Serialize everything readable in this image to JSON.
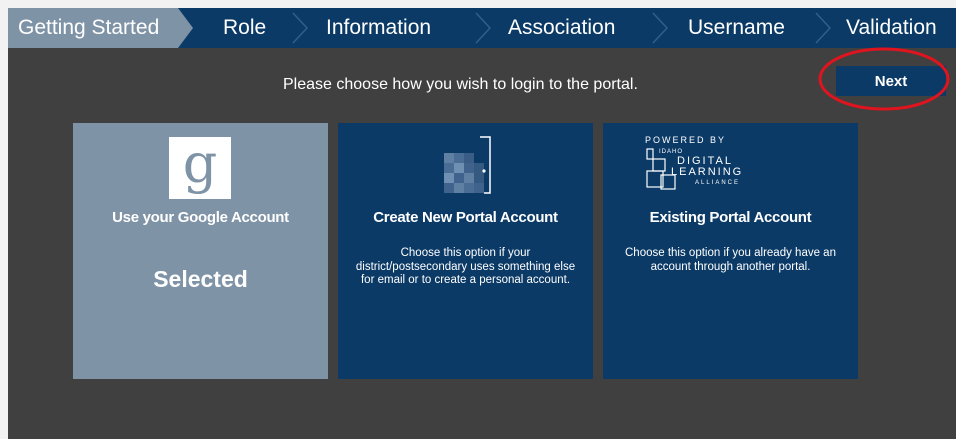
{
  "steps": [
    {
      "label": "Getting Started",
      "active": true
    },
    {
      "label": "Role"
    },
    {
      "label": "Information"
    },
    {
      "label": "Association"
    },
    {
      "label": "Username"
    },
    {
      "label": "Validation"
    }
  ],
  "main": {
    "prompt": "Please choose how you wish to login to the portal.",
    "next_label": "Next"
  },
  "cards": [
    {
      "icon": "google-g-icon",
      "logo_letter": "g",
      "title": "Use your Google Account",
      "status": "Selected",
      "selected": true
    },
    {
      "icon": "portal-door-icon",
      "title": "Create New Portal Account",
      "description": "Choose this option if your district/postsecondary uses something else for email or to create a personal account."
    },
    {
      "icon": "idla-logo",
      "logo_text": [
        "POWERED BY",
        "IDAHO",
        "DIGITAL",
        "LEARNING",
        "ALLIANCE"
      ],
      "title": "Existing Portal Account",
      "description": "Choose this option if you already have an account through another portal."
    }
  ],
  "colors": {
    "navy": "#0b3a66",
    "selected_gray_blue": "#7f93a7",
    "background": "#404040",
    "annotation_red": "#e0141e"
  }
}
